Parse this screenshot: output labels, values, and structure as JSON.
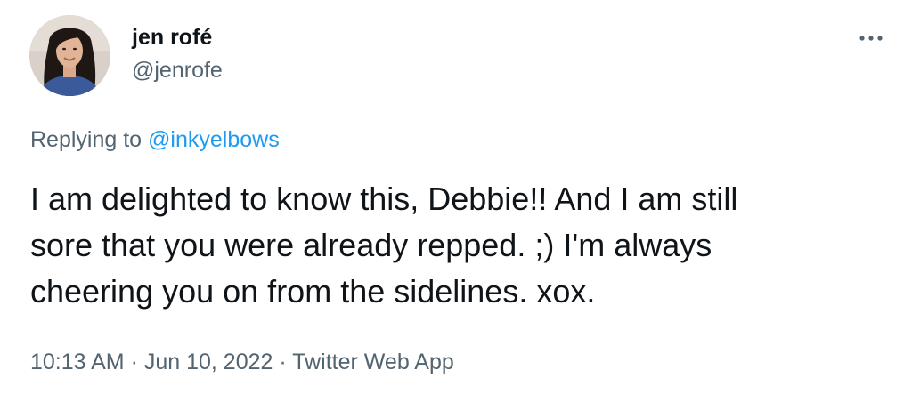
{
  "author": {
    "name": "jen rofé",
    "handle": "@jenrofe"
  },
  "reply": {
    "prefix": "Replying to ",
    "to": "@inkyelbows"
  },
  "tweet": {
    "line1": "I am delighted to know this, Debbie!! And I am still",
    "line2": "sore that you were already repped. ;) I'm always",
    "line3": "cheering you on from the sidelines. xox."
  },
  "meta": {
    "time": "10:13 AM",
    "sep1": " · ",
    "date": "Jun 10, 2022",
    "sep2": " · ",
    "source": "Twitter Web App"
  },
  "icons": {
    "more": "more-options-icon"
  },
  "colors": {
    "text": "#0f1419",
    "secondary": "#536471",
    "link": "#1d9bf0"
  }
}
